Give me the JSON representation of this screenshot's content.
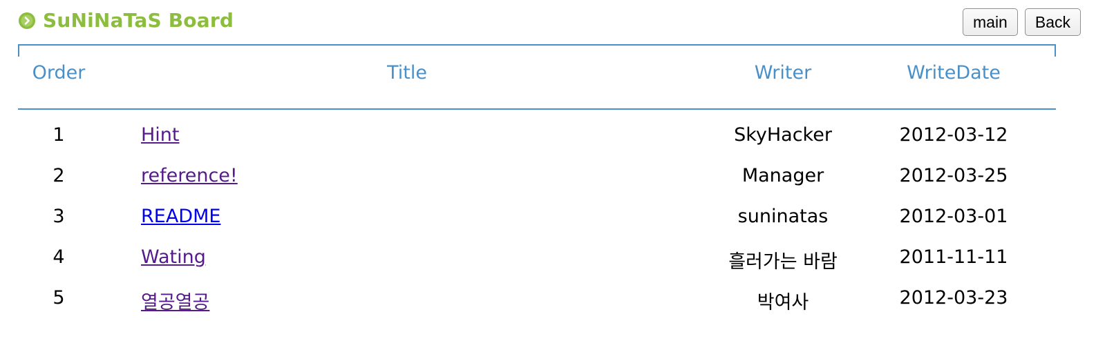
{
  "header": {
    "title": "SuNiNaTaS Board",
    "title_color": "#8dbd3f",
    "icon": "circle-chevron-right-icon",
    "buttons": {
      "main_label": "main",
      "back_label": "Back"
    }
  },
  "table": {
    "accent_color": "#4a90c8",
    "columns": {
      "order": "Order",
      "title": "Title",
      "writer": "Writer",
      "date": "WriteDate"
    },
    "rows": [
      {
        "order": "1",
        "title": "Hint",
        "writer": "SkyHacker",
        "date": "2012-03-12",
        "visited": true
      },
      {
        "order": "2",
        "title": "reference!",
        "writer": "Manager",
        "date": "2012-03-25",
        "visited": true
      },
      {
        "order": "3",
        "title": "README",
        "writer": "suninatas",
        "date": "2012-03-01",
        "visited": false
      },
      {
        "order": "4",
        "title": "Wating",
        "writer": "흘러가는 바람",
        "date": "2011-11-11",
        "visited": true
      },
      {
        "order": "5",
        "title": "열공열공",
        "writer": "박여사",
        "date": "2012-03-23",
        "visited": true
      }
    ]
  }
}
